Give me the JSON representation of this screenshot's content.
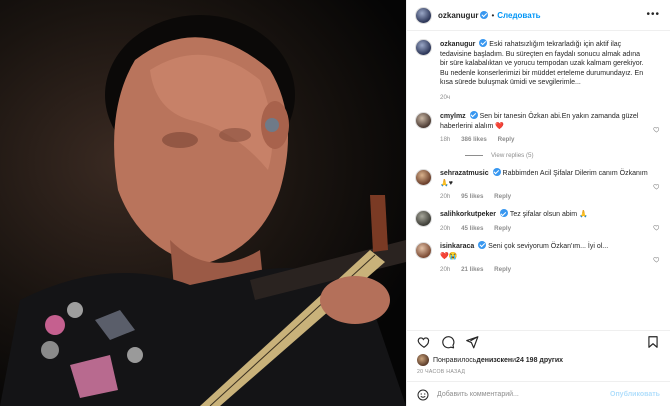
{
  "header": {
    "username": "ozkanugur",
    "separator": "•",
    "follow_label": "Следовать",
    "more_label": "•••"
  },
  "caption": {
    "username": "ozkanugur",
    "text": "Eski rahatsızlığım tekrarladığı için aktif ilaç tedavisine başladım. Bu süreçten en faydalı sonucu almak adına bir süre kalabalıktan ve yorucu tempodan uzak kalmam gerekiyor. Bu nedenle konserlerimizi bir müddet erteleme durumundayız. En kısa sürede buluşmak ümidi ve sevgilerimle...",
    "time": "20ч"
  },
  "comments": [
    {
      "username": "cmylmz",
      "text": "Sen bir tanesin Özkan abi.En yakın zamanda güzel haberlerini alalım",
      "emoji": "❤️",
      "time": "18h",
      "likes": "386 likes",
      "reply": "Reply",
      "view_replies": "View replies (5)"
    },
    {
      "username": "sehrazatmusic",
      "text": "Rabbimden Acil Şifalar Dilerim canım Özkanım",
      "emoji": "🙏♥",
      "time": "20h",
      "likes": "95 likes",
      "reply": "Reply"
    },
    {
      "username": "salihkorkutpeker",
      "text": "Tez şifalar olsun abim",
      "emoji": "🙏",
      "time": "20h",
      "likes": "45 likes",
      "reply": "Reply"
    },
    {
      "username": "isinkaraca",
      "text": "Seni çok seviyorum Özkan'ım... İyi ol...",
      "emoji": "❤️😭",
      "time": "20h",
      "likes": "21 likes",
      "reply": "Reply"
    }
  ],
  "likes_line": {
    "prefix": "Понравилось ",
    "user": "денизскен",
    "middle": " и ",
    "count": "24 198 других"
  },
  "timestamp": "20 ЧАСОВ НАЗАД",
  "add_comment": {
    "placeholder": "Добавить комментарий...",
    "publish_label": "Опубликовать"
  },
  "colors": {
    "accent": "#0095f6",
    "verified": "#3897f0",
    "heart": "#ed4956"
  },
  "icons": [
    "heart-icon",
    "comment-icon",
    "share-icon",
    "bookmark-icon",
    "emoji-icon",
    "more-icon",
    "verified-icon"
  ]
}
